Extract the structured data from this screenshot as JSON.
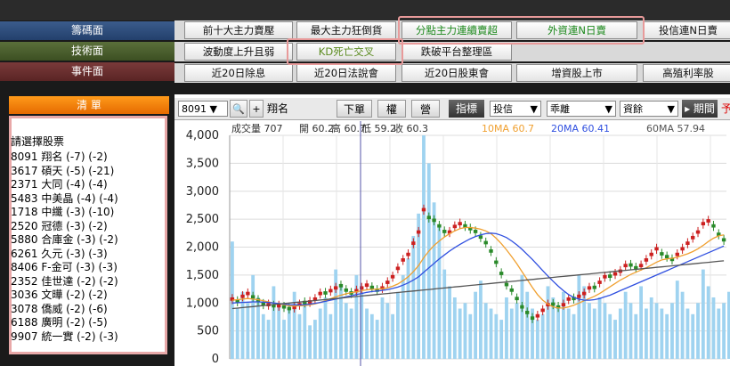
{
  "categories": {
    "chip": "籌碼面",
    "tech": "技術面",
    "event": "事件面"
  },
  "menu_row1": [
    "前十大主力賣壓",
    "最大主力狂倒貨",
    "分點主力連續賣超",
    "外資連N日賣",
    "投信連N日賣"
  ],
  "menu_row2": [
    "波動度上升且弱",
    "KD死亡交叉",
    "跌破平台整理區"
  ],
  "menu_row3": [
    "近20日除息",
    "近20日法說會",
    "近20日股東會",
    "增資股上市",
    "高殖利率股"
  ],
  "watchlist": {
    "header": "清  單",
    "title": "請選擇股票",
    "items": [
      "8091 翔名 (-7) (-2)",
      "3617 碩天 (-5) (-21)",
      "2371 大同 (-4) (-4)",
      "5483 中美晶 (-4) (-4)",
      "1718 中纖 (-3) (-10)",
      "2520 冠德 (-3) (-2)",
      "5880 合庫金 (-3) (-2)",
      "6261 久元 (-3) (-3)",
      "8406 F-金可 (-3) (-3)",
      "2352 佳世達 (-2) (-2)",
      "3036 文曄 (-2) (-2)",
      "3078 僑威 (-2) (-6)",
      "6188 廣明 (-2) (-5)",
      "9907 統一實 (-2) (-3)"
    ]
  },
  "toolbar": {
    "code": "8091",
    "name": "翔名",
    "btn_down": "下單",
    "btn_right": "權",
    "btn_op": "營",
    "indicator_label": "指標",
    "dd1": "投信",
    "dd2": "乖離",
    "dd3": "資餘",
    "period_label": "期間",
    "period_value": "予"
  },
  "info_line": {
    "vol": "成交量 707",
    "open": "開 60.2",
    "high": "高 60.7",
    "low": "低 59.2",
    "close": "收 60.3",
    "ma10": "10MA 60.7",
    "ma20": "20MA 60.41",
    "ma60": "60MA 57.94"
  },
  "colors": {
    "ma10": "#f0a030",
    "ma20": "#3050e0",
    "ma60": "#555555",
    "up": "#cc2020",
    "down": "#2a8a2a",
    "volume": "#9fd3f0"
  },
  "chart_data": {
    "type": "candlestick",
    "ylim": [
      0,
      4000
    ],
    "yticks": [
      "4,000",
      "3,500",
      "3,000",
      "2,500",
      "2,000",
      "1,500",
      "1,000",
      "500",
      "0"
    ],
    "volume": [
      2100,
      900,
      1200,
      1000,
      1500,
      1100,
      800,
      700,
      1300,
      1000,
      700,
      900,
      1200,
      800,
      1000,
      600,
      700,
      900,
      1100,
      800,
      1600,
      1300,
      1000,
      900,
      1500,
      1200,
      900,
      800,
      700,
      1100,
      1000,
      800,
      1200,
      1500,
      1800,
      2200,
      2600,
      4000,
      3500,
      2800,
      2400,
      1600,
      1300,
      1100,
      900,
      1000,
      800,
      1200,
      1400,
      1000,
      900,
      800,
      700,
      1100,
      900,
      1000,
      1500,
      1200,
      900,
      700,
      800,
      1300,
      1100,
      900,
      1200,
      900,
      800,
      1500,
      1300,
      1000,
      900,
      1100,
      1000,
      800,
      700,
      900,
      1200,
      1000,
      800,
      1300,
      900,
      1100,
      1000,
      900,
      800,
      1000,
      1400,
      1200,
      900,
      800,
      1000,
      1600,
      1300,
      1100,
      900,
      1000,
      1200
    ],
    "price": [
      1100,
      1000,
      1150,
      1200,
      1080,
      1020,
      950,
      1000,
      920,
      980,
      900,
      870,
      950,
      1000,
      980,
      1050,
      1100,
      1200,
      1150,
      1250,
      1300,
      1280,
      1200,
      1150,
      1250,
      1300,
      1350,
      1250,
      1200,
      1300,
      1400,
      1500,
      1650,
      1800,
      1900,
      2100,
      2300,
      2700,
      2500,
      2450,
      2350,
      2250,
      2300,
      2400,
      2450,
      2350,
      2300,
      2250,
      2150,
      2050,
      1900,
      1700,
      1500,
      1300,
      1200,
      1050,
      900,
      800,
      700,
      800,
      900,
      1000,
      950,
      900,
      1000,
      1100,
      1050,
      1150,
      1200,
      1300,
      1250,
      1400,
      1500,
      1450,
      1550,
      1600,
      1700,
      1650,
      1600,
      1700,
      1800,
      1900,
      2000,
      1850,
      1800,
      1750,
      1900,
      2000,
      2100,
      2200,
      2300,
      2450,
      2500,
      2350,
      2200,
      2100
    ],
    "ma10": [
      1050,
      1060,
      1070,
      1080,
      1070,
      1060,
      1040,
      1020,
      1000,
      985,
      970,
      950,
      945,
      950,
      955,
      965,
      985,
      1010,
      1040,
      1075,
      1110,
      1140,
      1165,
      1185,
      1200,
      1220,
      1235,
      1245,
      1250,
      1255,
      1270,
      1300,
      1340,
      1400,
      1470,
      1560,
      1670,
      1810,
      1930,
      2030,
      2110,
      2180,
      2240,
      2290,
      2330,
      2350,
      2350,
      2340,
      2320,
      2290,
      2240,
      2160,
      2060,
      1950,
      1830,
      1700,
      1560,
      1420,
      1280,
      1150,
      1050,
      980,
      930,
      910,
      910,
      930,
      960,
      1000,
      1040,
      1080,
      1120,
      1170,
      1230,
      1290,
      1350,
      1410,
      1460,
      1510,
      1550,
      1590,
      1630,
      1680,
      1730,
      1770,
      1790,
      1800,
      1820,
      1850,
      1880,
      1920,
      1970,
      2030,
      2100,
      2160,
      2200,
      2220
    ],
    "ma20": [
      1000,
      1005,
      1010,
      1015,
      1020,
      1020,
      1015,
      1010,
      1000,
      990,
      980,
      970,
      965,
      965,
      970,
      980,
      995,
      1010,
      1030,
      1050,
      1070,
      1090,
      1110,
      1130,
      1150,
      1170,
      1190,
      1205,
      1215,
      1225,
      1240,
      1260,
      1285,
      1320,
      1360,
      1410,
      1470,
      1550,
      1630,
      1710,
      1790,
      1860,
      1930,
      1990,
      2050,
      2100,
      2150,
      2190,
      2220,
      2240,
      2250,
      2240,
      2210,
      2170,
      2110,
      2040,
      1960,
      1870,
      1780,
      1680,
      1580,
      1480,
      1390,
      1300,
      1220,
      1150,
      1100,
      1070,
      1050,
      1050,
      1060,
      1080,
      1110,
      1140,
      1180,
      1220,
      1260,
      1300,
      1340,
      1380,
      1420,
      1460,
      1500,
      1540,
      1580,
      1620,
      1660,
      1700,
      1740,
      1780,
      1820,
      1860,
      1900,
      1940,
      1980,
      2020
    ]
  }
}
